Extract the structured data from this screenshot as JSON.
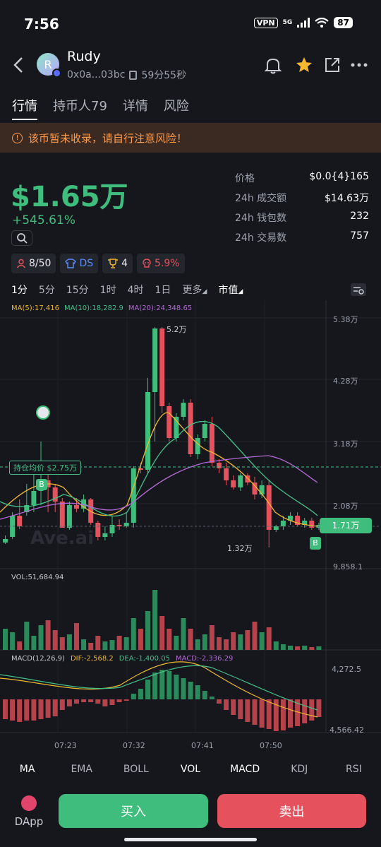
{
  "status_bar": {
    "time": "7:56",
    "vpn": "VPN",
    "network": "5G",
    "battery": "87"
  },
  "token": {
    "name": "Rudy",
    "avatar_letter": "R",
    "address": "0x0a...03bc",
    "age": "59分55秒"
  },
  "tabs": [
    "行情",
    "持币人79",
    "详情",
    "风险"
  ],
  "warning": "该币暂未收录，请自行注意风险！",
  "price": {
    "value": "$1.65万",
    "change": "+545.61%"
  },
  "stats": [
    {
      "label": "价格",
      "value": "$0.0{4}165"
    },
    {
      "label": "24h 成交额",
      "value": "$14.63万"
    },
    {
      "label": "24h 钱包数",
      "value": "232"
    },
    {
      "label": "24h 交易数",
      "value": "757"
    }
  ],
  "badges": {
    "holders": "8/50",
    "ds": "DS",
    "trophy": "4",
    "risk": "5.9%"
  },
  "timeframes": [
    "1分",
    "5分",
    "15分",
    "1时",
    "4时",
    "1日",
    "更多",
    "市值"
  ],
  "chart_data": {
    "type": "candlestick",
    "ma_legend": {
      "ma5": "MA(5):17,416",
      "ma10": "MA(10):18,282.9",
      "ma20": "MA(20):24,348.65"
    },
    "y_ticks": [
      "5.38万",
      "4.28万",
      "3.18万",
      "2.08万",
      "9,858.1"
    ],
    "high_label": "5.2万",
    "low_label": "1.32万",
    "hold_label": "持仓均价 $2.75万",
    "current_label": "1.71万",
    "vol_label": "VOL:51,684.94",
    "macd": {
      "title": "MACD(12,26,9)",
      "dif": "DIF:-2,568.2",
      "dea": "DEA:-1,400.05",
      "macd": "MACD:-2,336.29",
      "top": "4,272.5",
      "bottom": "4,566.42"
    },
    "x_ticks": [
      "07:23",
      "07:32",
      "07:41",
      "07:50"
    ],
    "watermark": "Ave.ai",
    "marker_buy": "B"
  },
  "indicators": [
    "MA",
    "EMA",
    "BOLL",
    "VOL",
    "MACD",
    "KDJ",
    "RSI"
  ],
  "actions": {
    "dapp": "DApp",
    "buy": "买入",
    "sell": "卖出"
  }
}
